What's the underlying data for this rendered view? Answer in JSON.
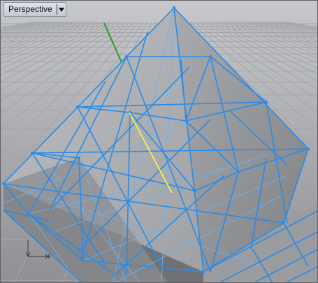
{
  "viewport": {
    "view_name": "Perspective",
    "dropdown_icon": "chevron-down-icon",
    "axis_icon": "world-axes-icon"
  },
  "colors": {
    "background_top": "#c9cbce",
    "background_bottom": "#8e9095",
    "grid": "#9ea0a5",
    "mesh_edges": "#2a8be8",
    "selected_curve": "#ffff30",
    "world_axis_y": "#2a9a2a",
    "face_dark": "#6f7175",
    "face_light": "#b4b6ba"
  }
}
